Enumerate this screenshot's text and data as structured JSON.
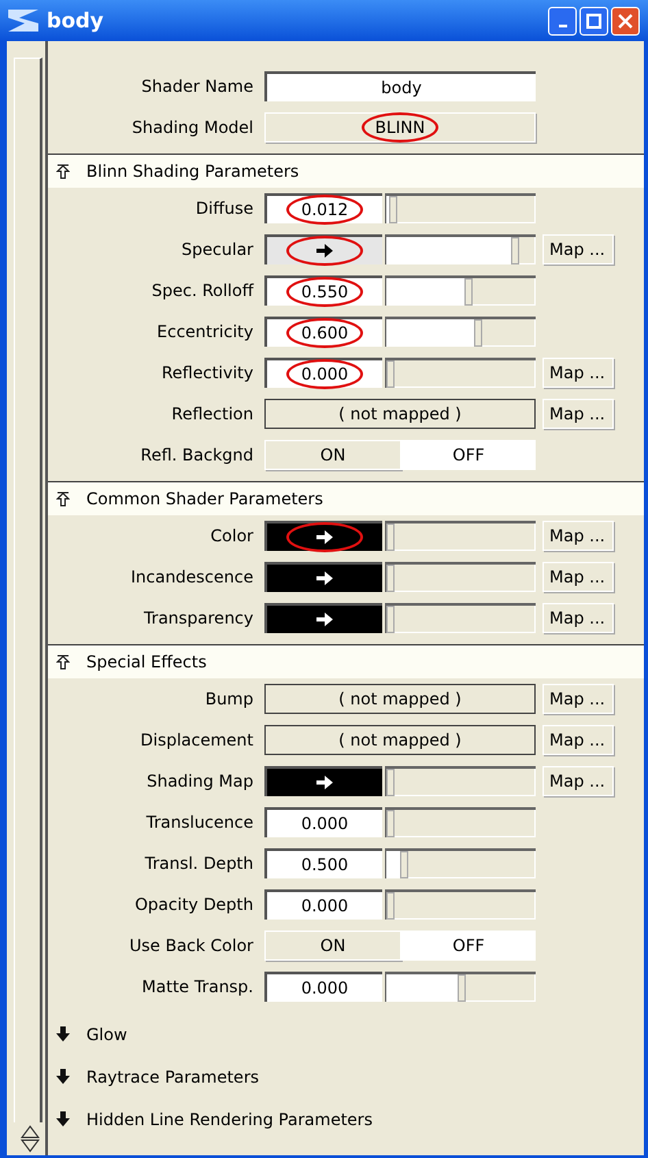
{
  "window": {
    "title": "body"
  },
  "header_rows": [
    {
      "kind": "text",
      "label": "Shader Name",
      "value": "body",
      "highlighted": false
    },
    {
      "kind": "select",
      "label": "Shading Model",
      "value": "BLINN",
      "highlighted": true
    }
  ],
  "sections": [
    {
      "title": "Blinn Shading Parameters",
      "expanded": true,
      "rows": [
        {
          "kind": "number",
          "label": "Diffuse",
          "value": "0.012",
          "level": 0.02,
          "highlighted": true
        },
        {
          "kind": "swatch",
          "label": "Specular",
          "color": "#e6e6e6",
          "level": 0.88,
          "map": "Map ...",
          "highlighted": true
        },
        {
          "kind": "number",
          "label": "Spec. Rolloff",
          "value": "0.550",
          "level": 0.55,
          "highlighted": true
        },
        {
          "kind": "number",
          "label": "Eccentricity",
          "value": "0.600",
          "level": 0.62,
          "highlighted": true
        },
        {
          "kind": "number",
          "label": "Reflectivity",
          "value": "0.000",
          "level": 0,
          "map": "Map ...",
          "highlighted": true
        },
        {
          "kind": "mapped",
          "label": "Reflection",
          "value": "( not mapped )",
          "map": "Map ...",
          "highlighted": false
        },
        {
          "kind": "toggle",
          "label": "Refl. Backgnd",
          "options": [
            {
              "label": "ON",
              "selected": false
            },
            {
              "label": "OFF",
              "selected": true
            }
          ],
          "highlighted": false
        }
      ]
    },
    {
      "title": "Common Shader Parameters",
      "expanded": true,
      "rows": [
        {
          "kind": "swatch",
          "label": "Color",
          "color": "#000000",
          "level": 0,
          "map": "Map ...",
          "highlighted": true
        },
        {
          "kind": "swatch",
          "label": "Incandescence",
          "color": "#000000",
          "level": 0,
          "map": "Map ...",
          "highlighted": false
        },
        {
          "kind": "swatch",
          "label": "Transparency",
          "color": "#000000",
          "level": 0,
          "map": "Map ...",
          "highlighted": false
        }
      ]
    },
    {
      "title": "Special Effects",
      "expanded": true,
      "rows": [
        {
          "kind": "mapped",
          "label": "Bump",
          "value": "( not mapped )",
          "map": "Map ...",
          "highlighted": false
        },
        {
          "kind": "mapped",
          "label": "Displacement",
          "value": "( not mapped )",
          "map": "Map ...",
          "highlighted": false
        },
        {
          "kind": "swatch",
          "label": "Shading Map",
          "color": "#000000",
          "level": 0,
          "map": "Map ...",
          "highlighted": false
        },
        {
          "kind": "number",
          "label": "Translucence",
          "value": "0.000",
          "level": 0,
          "highlighted": false
        },
        {
          "kind": "number",
          "label": "Transl. Depth",
          "value": "0.500",
          "level": 0.1,
          "highlighted": false
        },
        {
          "kind": "number",
          "label": "Opacity Depth",
          "value": "0.000",
          "level": 0,
          "highlighted": false
        },
        {
          "kind": "toggle",
          "label": "Use Back Color",
          "options": [
            {
              "label": "ON",
              "selected": false
            },
            {
              "label": "OFF",
              "selected": true
            }
          ],
          "highlighted": false
        },
        {
          "kind": "number",
          "label": "Matte Transp.",
          "value": "0.000",
          "level": 0.5,
          "highlighted": false
        }
      ]
    },
    {
      "title": "Glow",
      "expanded": false
    },
    {
      "title": "Raytrace Parameters",
      "expanded": false
    },
    {
      "title": "Hidden Line Rendering Parameters",
      "expanded": false
    }
  ]
}
